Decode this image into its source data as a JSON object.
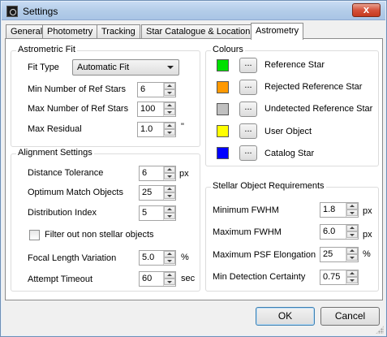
{
  "window": {
    "title": "Settings",
    "close_glyph": "x"
  },
  "tabs": [
    {
      "label": "General"
    },
    {
      "label": "Photometry"
    },
    {
      "label": "Tracking"
    },
    {
      "label": "Star Catalogue & Location"
    },
    {
      "label": "Astrometry"
    }
  ],
  "active_tab": "Astrometry",
  "astrometric_fit": {
    "title": "Astrometric Fit",
    "fit_type_label": "Fit Type",
    "fit_type_value": "Automatic Fit",
    "min_ref_label": "Min Number of Ref Stars",
    "min_ref_value": "6",
    "max_ref_label": "Max Number of Ref Stars",
    "max_ref_value": "100",
    "max_residual_label": "Max Residual",
    "max_residual_value": "1.0",
    "max_residual_unit": "\""
  },
  "alignment": {
    "title": "Alignment Settings",
    "distance_label": "Distance Tolerance",
    "distance_value": "6",
    "distance_unit": "px",
    "optimum_label": "Optimum Match Objects",
    "optimum_value": "25",
    "distribution_label": "Distribution Index",
    "distribution_value": "5",
    "filter_label": "Filter out non stellar objects",
    "filter_checked": false,
    "focal_label": "Focal Length Variation",
    "focal_value": "5.0",
    "focal_unit": "%",
    "timeout_label": "Attempt Timeout",
    "timeout_value": "60",
    "timeout_unit": "sec"
  },
  "colours": {
    "title": "Colours",
    "button_label": "...",
    "items": [
      {
        "label": "Reference Star",
        "color": "#00e000"
      },
      {
        "label": "Rejected Reference Star",
        "color": "#ff9900"
      },
      {
        "label": "Undetected Reference Star",
        "color": "#c0c0c0"
      },
      {
        "label": "User Object",
        "color": "#ffff00"
      },
      {
        "label": "Catalog Star",
        "color": "#0000ff"
      }
    ]
  },
  "stellar": {
    "title": "Stellar Object Requirements",
    "min_fwhm_label": "Minimum FWHM",
    "min_fwhm_value": "1.8",
    "min_fwhm_unit": "px",
    "max_fwhm_label": "Maximum FWHM",
    "max_fwhm_value": "6.0",
    "max_fwhm_unit": "px",
    "psf_label": "Maximum PSF Elongation",
    "psf_value": "25",
    "psf_unit": "%",
    "certainty_label": "Min Detection Certainty",
    "certainty_value": "0.75"
  },
  "buttons": {
    "ok": "OK",
    "cancel": "Cancel"
  }
}
